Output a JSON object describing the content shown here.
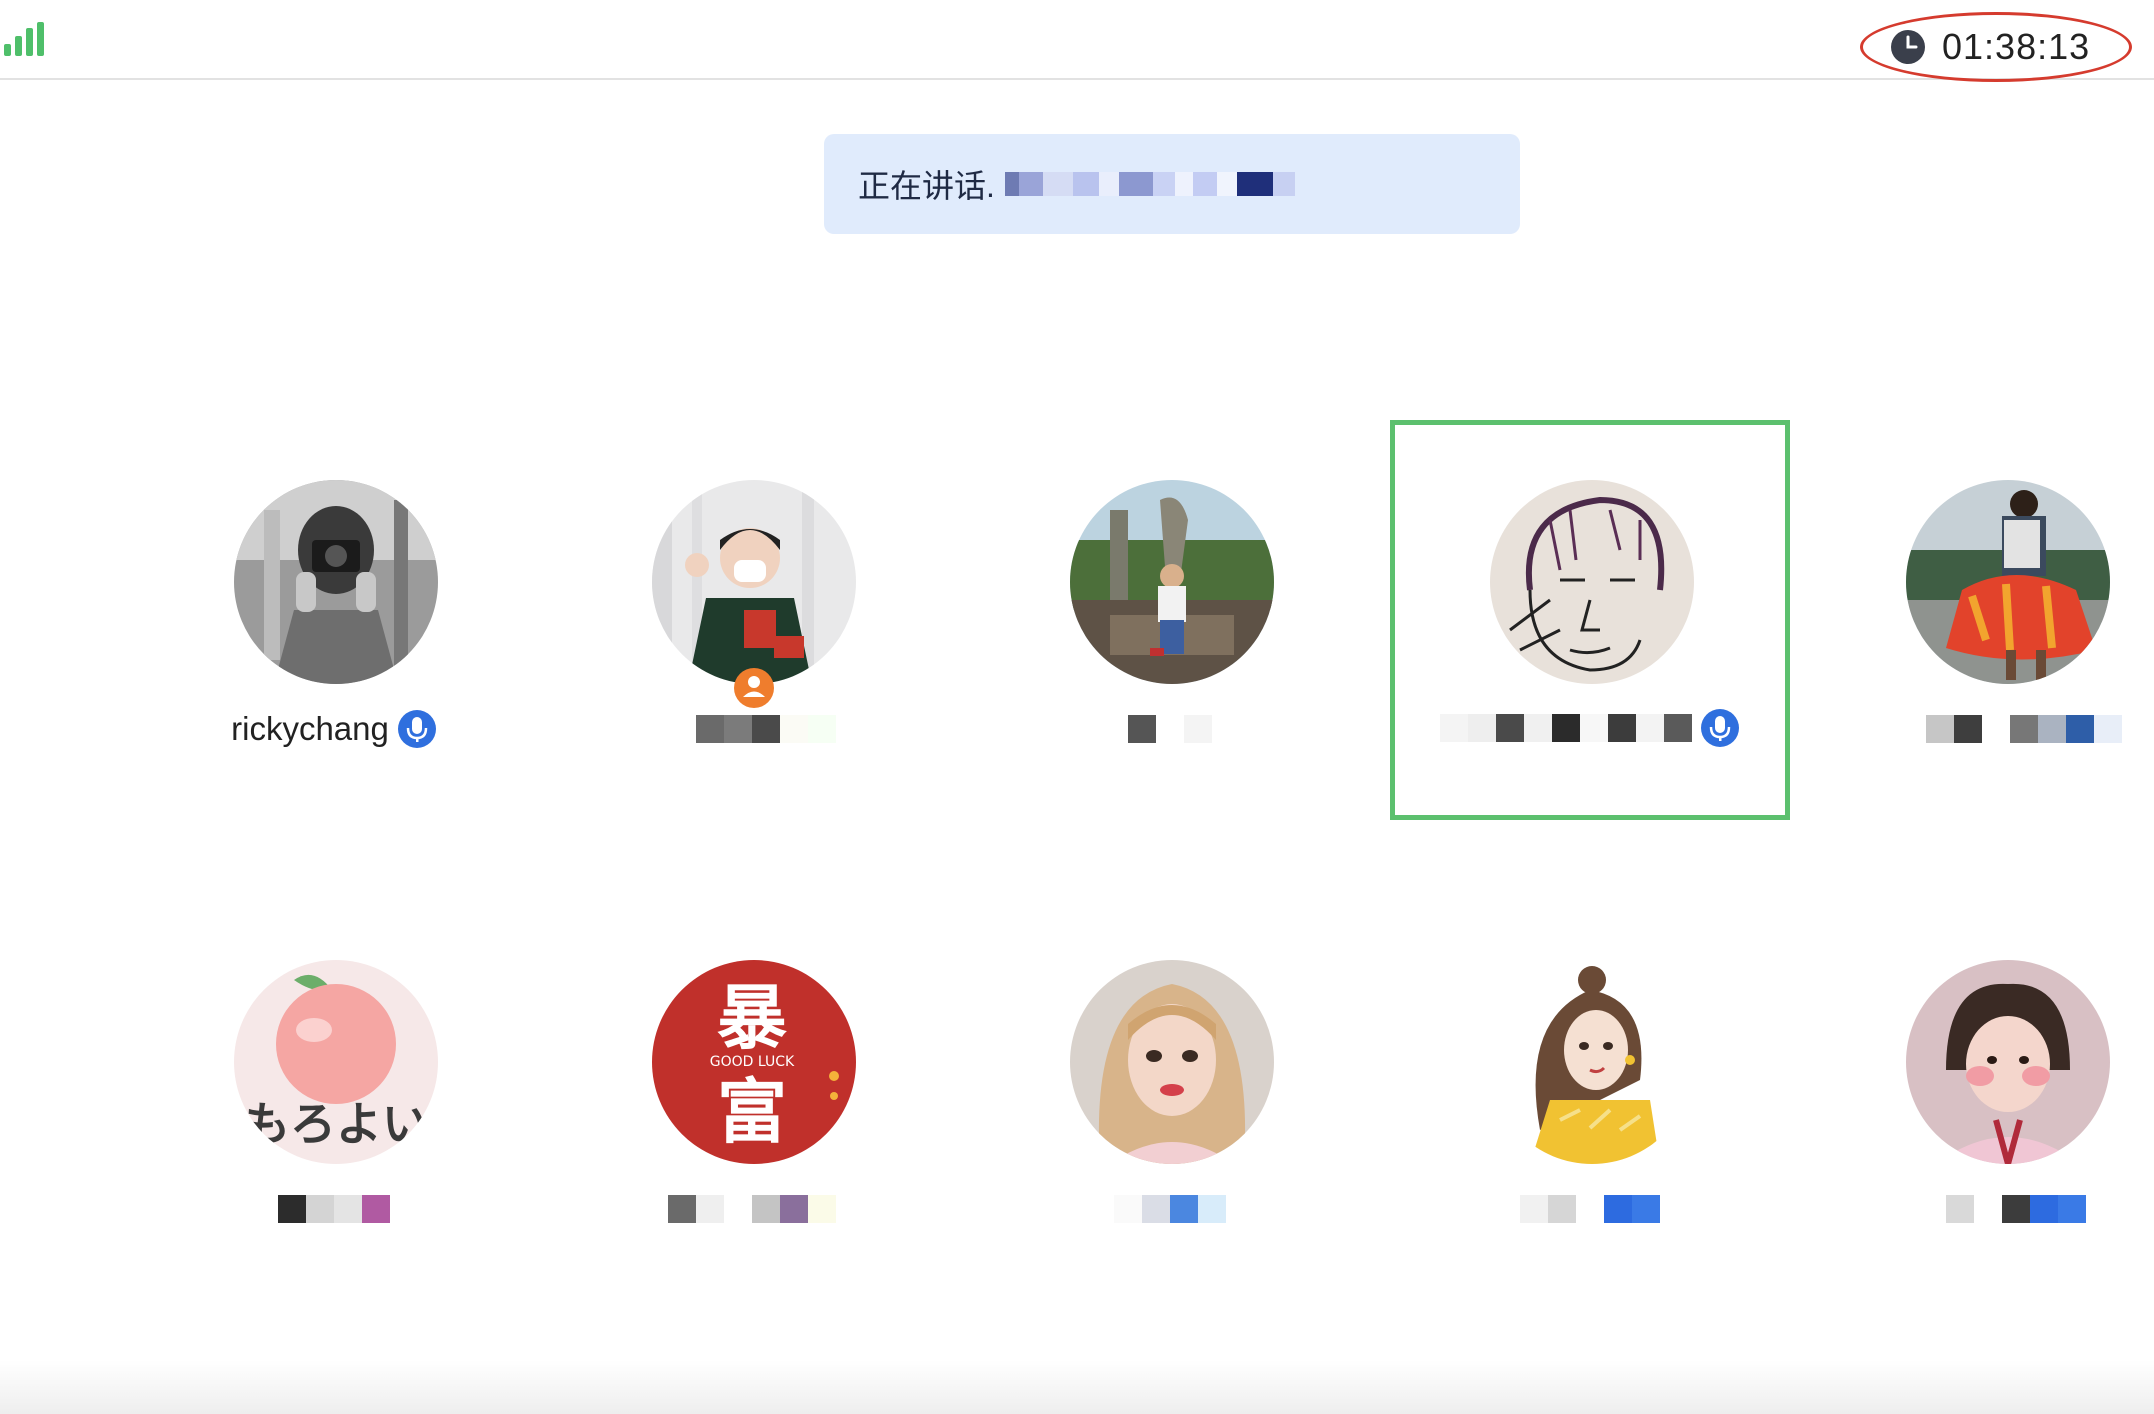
{
  "status_bar": {
    "signal_icon": "signal-bars-icon",
    "signal_color": "#4fbf6a",
    "timer": "01:38:13",
    "timer_highlight_color": "#d53b2e"
  },
  "speaking_banner": {
    "label": "正在讲话. ",
    "name_obscured": true
  },
  "participants": [
    {
      "name": "rickychang",
      "avatar": "photographer-bw",
      "speaking": true,
      "active": false
    },
    {
      "name": "",
      "avatar": "person-green-sweater",
      "host": true,
      "active": false
    },
    {
      "name": "",
      "avatar": "man-sitting-park",
      "active": false
    },
    {
      "name": "",
      "avatar": "sketch-face",
      "speaking": true,
      "active": true
    },
    {
      "name": "",
      "avatar": "man-backpack-skirt",
      "active": false
    },
    {
      "name": "",
      "avatar": "peach-illustration",
      "active": false
    },
    {
      "name": "",
      "avatar": "red-good-luck",
      "active": false
    },
    {
      "name": "",
      "avatar": "woman-selfie",
      "active": false
    },
    {
      "name": "",
      "avatar": "cartoon-woman-yellow",
      "active": false
    },
    {
      "name": "",
      "avatar": "costume-child",
      "active": false
    }
  ],
  "avatar_texts": {
    "good_luck_top": "暴",
    "good_luck_middle": "GOOD LUCK",
    "good_luck_bottom": "富",
    "peach_text": "もろよい"
  },
  "accent_colors": {
    "mic": "#2f6fde",
    "active_border": "#5cc06e",
    "banner_bg": "#e0ebfc",
    "host_badge": "#ef7d2d"
  }
}
